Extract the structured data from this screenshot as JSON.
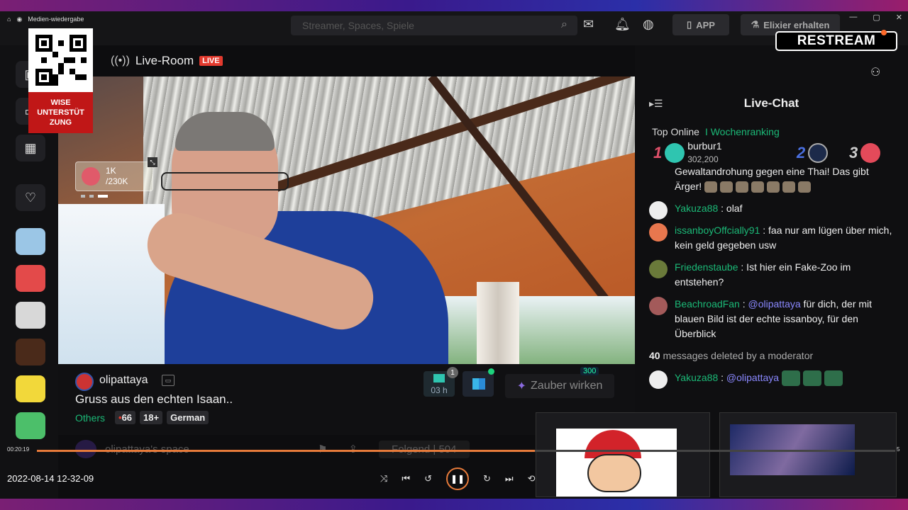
{
  "window": {
    "title": "Medien-wiedergabe",
    "controls": [
      "—",
      "▢",
      "✕"
    ]
  },
  "topbar": {
    "search_placeholder": "Streamer, Spaces, Spiele",
    "app_label": "APP",
    "elixir_label": "Elixier erhalten",
    "overlay": "RESTREAM"
  },
  "badge": {
    "line1": "WISE",
    "line2": "UNTERSTÜT",
    "line3": "ZUNG"
  },
  "room": {
    "title": "Live-Room",
    "live_badge": "LIVE"
  },
  "gift": {
    "count": "1K",
    "goal": "/230K"
  },
  "stream": {
    "streamer": "olipattaya",
    "description": "Gruss aus den echten Isaan..",
    "category": "Others",
    "viewers": "66",
    "age_tag": "18+",
    "language_tag": "German",
    "timer_value": "03 h",
    "timer_badge": "1",
    "magic_label": "Zauber wirken",
    "magic_cost": "300",
    "space_label": "olipattaya's space",
    "follow_label": "Folgend | 504"
  },
  "chat": {
    "title": "Live-Chat",
    "tab_top": "Top Online",
    "tab_week": "I Wochenranking",
    "top1_rank": "1",
    "top1_name": "burbur1",
    "top1_points": "302,200",
    "top2_rank": "2",
    "top3_rank": "3",
    "messages": [
      {
        "user": "",
        "text": "Gewaltandrohung gegen eine Thai! Das gibt Ärger!"
      },
      {
        "user": "Yakuza88",
        "text": " : olaf"
      },
      {
        "user": "issanboyOffcially91",
        "text": " : faa nur am lügen über mich, kein geld gegeben usw"
      },
      {
        "user": "Friedenstaube",
        "text": " : Ist hier ein Fake-Zoo im entstehen?"
      },
      {
        "user": "BeachroadFan",
        "mention": "@olipattaya",
        "text": " für dich, der mit blauen Bild ist der echte issanboy, für den Überblick"
      },
      {
        "user": "Yakuza88",
        "mention": "@olipattaya",
        "text": ""
      }
    ],
    "deleted_count": "40",
    "deleted_text": " messages deleted by a moderator"
  },
  "playback": {
    "current_time": "00:20:19",
    "end_time": "5",
    "progress": 0.58,
    "filename": "2022-08-14 12-32-09"
  },
  "colors": {
    "accent_orange": "#e67a3a",
    "live_red": "#e33a2e",
    "chat_green": "#1bb977",
    "mention_purple": "#8a88ff"
  }
}
